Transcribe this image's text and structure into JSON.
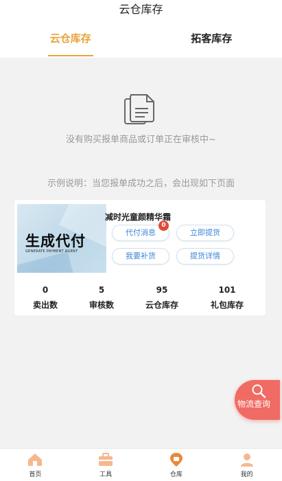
{
  "header": {
    "title": "云仓库存"
  },
  "tabs": [
    {
      "label": "云仓库存",
      "active": true
    },
    {
      "label": "拓客库存",
      "active": false
    }
  ],
  "empty": {
    "message": "没有购买报单商品或订单正在审核中~"
  },
  "example": {
    "text": "示例说明：当您报单成功之后，会出现如下页面"
  },
  "card": {
    "image_title": "生成代付",
    "image_subtitle": "GENERATE PAYMENT AGENT",
    "product_name": "减时光童颜精华霜",
    "buttons": {
      "messages": "代付消息",
      "pickup": "立即提货",
      "restock": "我要补货",
      "pickup_details": "提货详情"
    },
    "badge_count": "0",
    "stats": [
      {
        "value": "0",
        "label": "卖出数"
      },
      {
        "value": "5",
        "label": "审核数"
      },
      {
        "value": "95",
        "label": "云仓库存"
      },
      {
        "value": "101",
        "label": "礼包库存"
      }
    ]
  },
  "float_button": {
    "label": "物流查询"
  },
  "bottom_nav": [
    {
      "label": "首页"
    },
    {
      "label": "工具"
    },
    {
      "label": "仓库"
    },
    {
      "label": "我的"
    }
  ],
  "colors": {
    "accent": "#e9a23b",
    "link_blue": "#3d86d8",
    "badge_red": "#e04a3a",
    "float_red": "#f06b63"
  }
}
